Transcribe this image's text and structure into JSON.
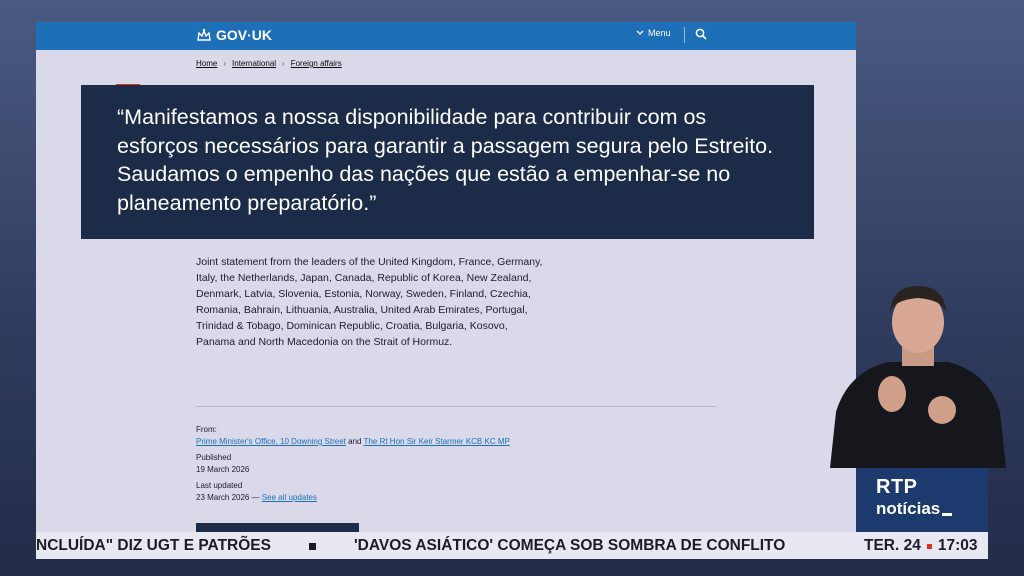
{
  "govuk": {
    "logo_text": "GOV·UK",
    "menu_label": "Menu"
  },
  "breadcrumb": [
    "Home",
    "International",
    "Foreign affairs"
  ],
  "quote": "“Manifestamos a nossa disponibilidade para contribuir com os esforços necessários para garantir a passagem segura pelo Estreito. Saudamos o empenho das nações que estão a empenhar-se no planeamento preparatório.”",
  "statement": "Joint statement from the leaders of the United Kingdom, France, Germany, Italy, the Netherlands, Japan, Canada, Republic of Korea, New Zealand, Denmark, Latvia, Slovenia, Estonia, Norway, Sweden, Finland, Czechia, Romania, Bahrain, Lithuania, Australia, United Arab Emirates, Portugal, Trinidad & Tobago, Dominican Republic, Croatia, Bulgaria, Kosovo, Panama and North Macedonia on the Strait of Hormuz.",
  "meta": {
    "from_label": "From:",
    "from_org_1": "Prime Minister's Office, 10 Downing Street",
    "and_label": "and",
    "from_org_2": "The Rt Hon Sir Keir Starmer KCB KC MP",
    "published_label": "Published",
    "published_date": "19 March 2026",
    "updated_label": "Last updated",
    "updated_date": "23 March 2026",
    "updated_sep": "—",
    "see_all_updates": "See all updates"
  },
  "broadcast": {
    "logo_top": "RTP",
    "logo_bottom": "notícias",
    "ticker_1": "NCLUÍDA\" DIZ UGT E PATRÕES",
    "ticker_2": "'DAVOS ASIÁTICO' COMEÇA SOB SOMBRA DE CONFLITO",
    "day": "TER. 24",
    "time": "17:03"
  }
}
